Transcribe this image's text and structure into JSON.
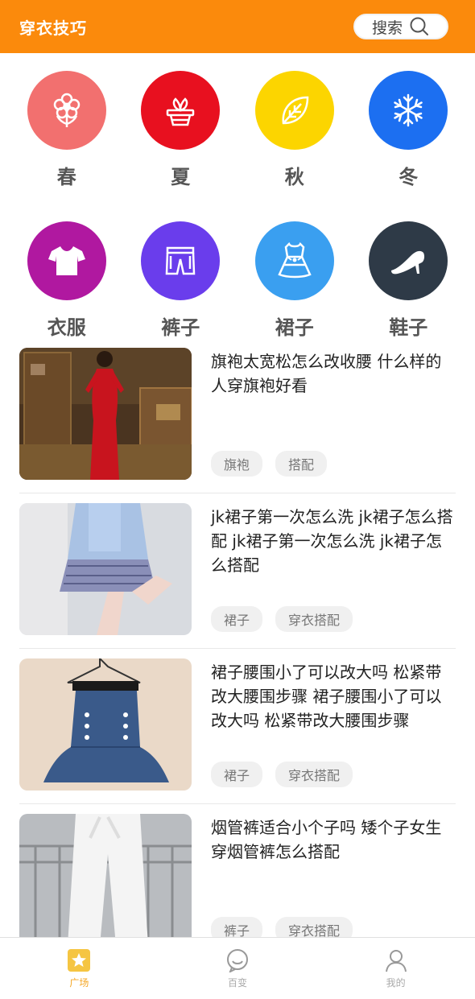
{
  "header": {
    "title": "穿衣技巧",
    "search_label": "搜索"
  },
  "categories": [
    {
      "label": "春",
      "color": "#f2706f",
      "icon": "flower-icon"
    },
    {
      "label": "夏",
      "color": "#e8101f",
      "icon": "potted-plant-icon"
    },
    {
      "label": "秋",
      "color": "#fcd500",
      "icon": "leaf-icon"
    },
    {
      "label": "冬",
      "color": "#1c6ff1",
      "icon": "snowflake-icon"
    },
    {
      "label": "衣服",
      "color": "#b018a0",
      "icon": "shirt-icon"
    },
    {
      "label": "裤子",
      "color": "#6a3dec",
      "icon": "shorts-icon"
    },
    {
      "label": "裙子",
      "color": "#3a9ff0",
      "icon": "dress-icon"
    },
    {
      "label": "鞋子",
      "color": "#2e3a47",
      "icon": "high-heel-icon"
    }
  ],
  "feed": [
    {
      "title": "旗袍太宽松怎么改收腰 什么样的人穿旗袍好看",
      "tags": [
        "旗袍",
        "搭配"
      ]
    },
    {
      "title": "jk裙子第一次怎么洗 jk裙子怎么搭配 jk裙子第一次怎么洗 jk裙子怎么搭配",
      "tags": [
        "裙子",
        "穿衣搭配"
      ]
    },
    {
      "title": "裙子腰围小了可以改大吗 松紧带改大腰围步骤 裙子腰围小了可以改大吗 松紧带改大腰围步骤",
      "tags": [
        "裙子",
        "穿衣搭配"
      ]
    },
    {
      "title": "烟管裤适合小个子吗 矮个子女生穿烟管裤怎么搭配",
      "tags": [
        "裤子",
        "穿衣搭配"
      ]
    }
  ],
  "tabbar": [
    {
      "label": "广场",
      "icon": "star-icon",
      "active": true
    },
    {
      "label": "百变",
      "icon": "chat-bubble-icon",
      "active": false
    },
    {
      "label": "我的",
      "icon": "user-icon",
      "active": false
    }
  ],
  "colors": {
    "brand": "#fb8a0c",
    "active_tab": "#f5a623"
  }
}
